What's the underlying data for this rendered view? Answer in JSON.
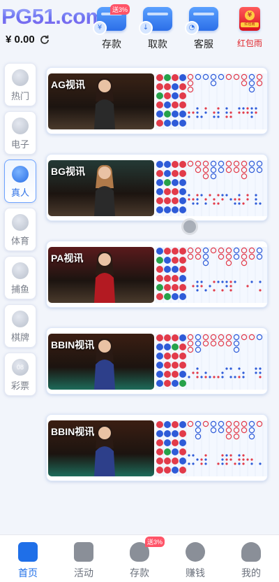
{
  "header": {
    "logo_text": "PG51.com",
    "balance": "¥ 0.00",
    "actions": [
      {
        "label": "存款",
        "icon": "deposit-wallet-icon",
        "badge": "送3%"
      },
      {
        "label": "取款",
        "icon": "withdraw-wallet-icon"
      },
      {
        "label": "客服",
        "icon": "customer-service-icon"
      },
      {
        "label": "红包雨",
        "icon": "red-envelope-icon",
        "icon_caption": "红包雨",
        "color": "#e0242a"
      }
    ]
  },
  "sidebar": {
    "items": [
      {
        "label": "热门",
        "icon": "flame-icon"
      },
      {
        "label": "电子",
        "icon": "gamepad-icon"
      },
      {
        "label": "真人",
        "icon": "live-dealer-icon",
        "active": true
      },
      {
        "label": "体育",
        "icon": "soccer-ball-icon"
      },
      {
        "label": "捕鱼",
        "icon": "fish-icon"
      },
      {
        "label": "棋牌",
        "icon": "cards-icon"
      },
      {
        "label": "彩票",
        "icon": "lottery-ball-icon",
        "icon_text": "08"
      }
    ]
  },
  "games": [
    {
      "name": "AG视讯",
      "theme": "#3a2316"
    },
    {
      "name": "BG视讯",
      "theme": "#243a36"
    },
    {
      "name": "PA视讯",
      "theme": "#5a1a1c"
    },
    {
      "name": "BBIN视讯",
      "theme": "#3b1e12"
    },
    {
      "name": "BBIN视讯",
      "theme": "#3b1e12"
    }
  ],
  "bottom_nav": [
    {
      "label": "首页",
      "icon": "home-icon",
      "active": true
    },
    {
      "label": "活动",
      "icon": "gift-icon"
    },
    {
      "label": "存款",
      "icon": "money-bag-icon",
      "badge": "送3%"
    },
    {
      "label": "赚钱",
      "icon": "coin-icon"
    },
    {
      "label": "我的",
      "icon": "user-icon"
    }
  ],
  "colors": {
    "accent": "#2b6fe6",
    "banker_red": "#e23b4a",
    "player_blue": "#2e5bd8",
    "tie_green": "#27a24a"
  }
}
